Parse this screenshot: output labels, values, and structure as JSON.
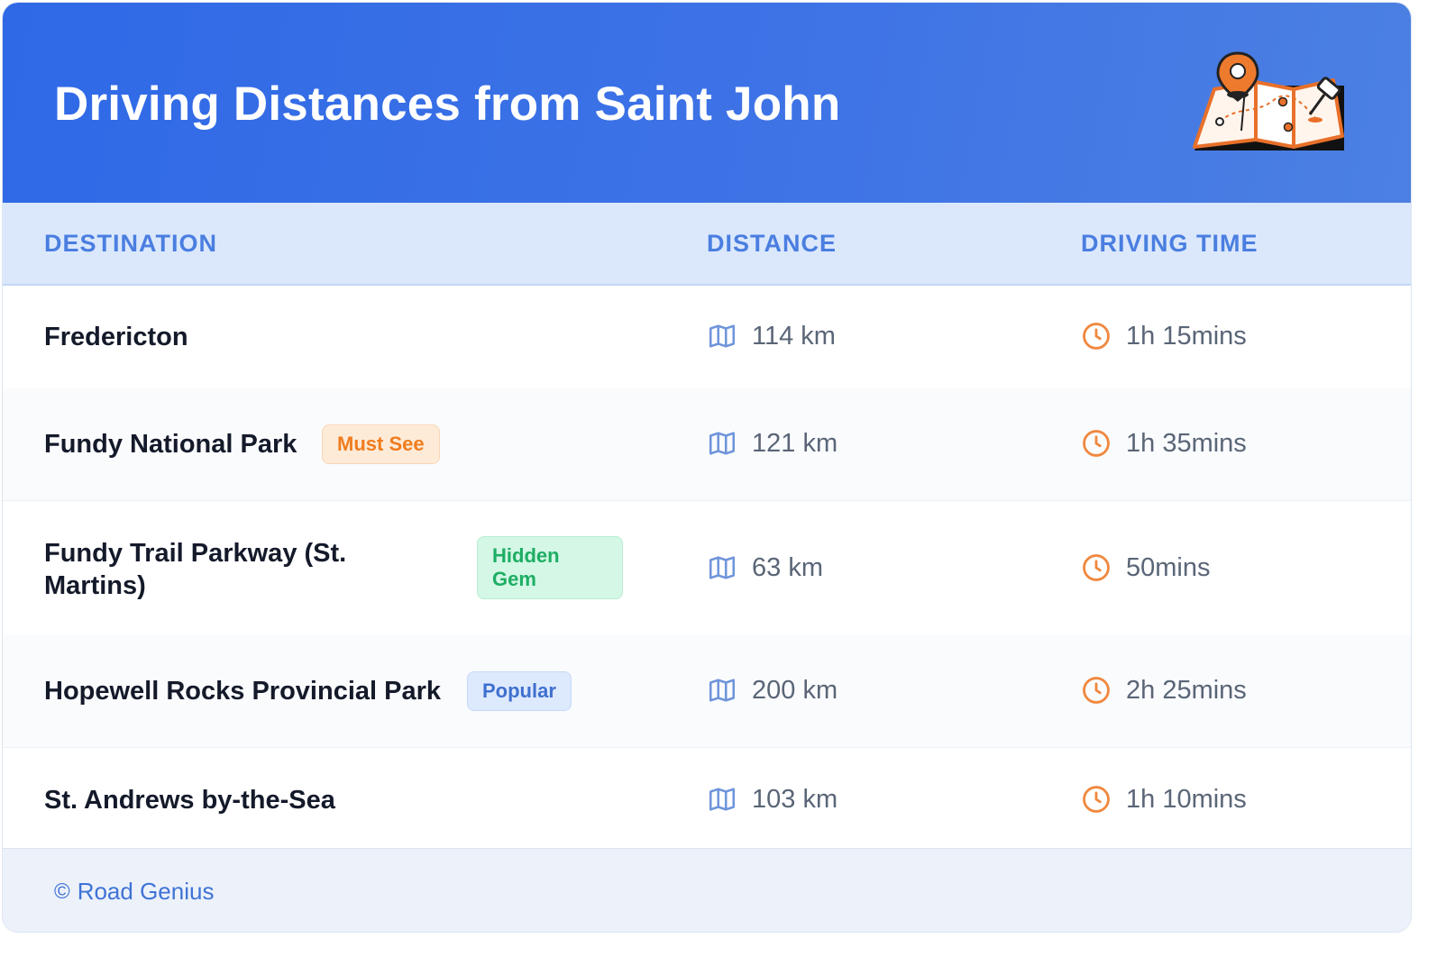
{
  "header": {
    "title": "Driving Distances from Saint John"
  },
  "columns": [
    "DESTINATION",
    "DISTANCE",
    "DRIVING TIME"
  ],
  "rows": [
    {
      "destination": "Fredericton",
      "distance": "114 km",
      "time": "1h 15mins",
      "badge": null
    },
    {
      "destination": "Fundy National Park",
      "distance": "121 km",
      "time": "1h 35mins",
      "badge": "Must See"
    },
    {
      "destination": "Fundy Trail Parkway (St. Martins)",
      "distance": "63 km",
      "time": "50mins",
      "badge": "Hidden Gem"
    },
    {
      "destination": "Hopewell Rocks Provincial Park",
      "distance": "200 km",
      "time": "2h 25mins",
      "badge": "Popular"
    },
    {
      "destination": "St. Andrews by-the-Sea",
      "distance": "103 km",
      "time": "1h 10mins",
      "badge": null
    }
  ],
  "footer": {
    "copyright_symbol": "©",
    "brand": "Road Genius"
  },
  "icons": {
    "distance": "map-icon",
    "time": "clock-icon",
    "header": "map-pin-illustration"
  },
  "colors": {
    "header": "#3369e6",
    "accent": "#4a7ee0",
    "badge_must_see": "#f07c1e",
    "badge_hidden_gem": "#1dae63",
    "badge_popular": "#3f70cf",
    "clock": "#f0883e"
  }
}
